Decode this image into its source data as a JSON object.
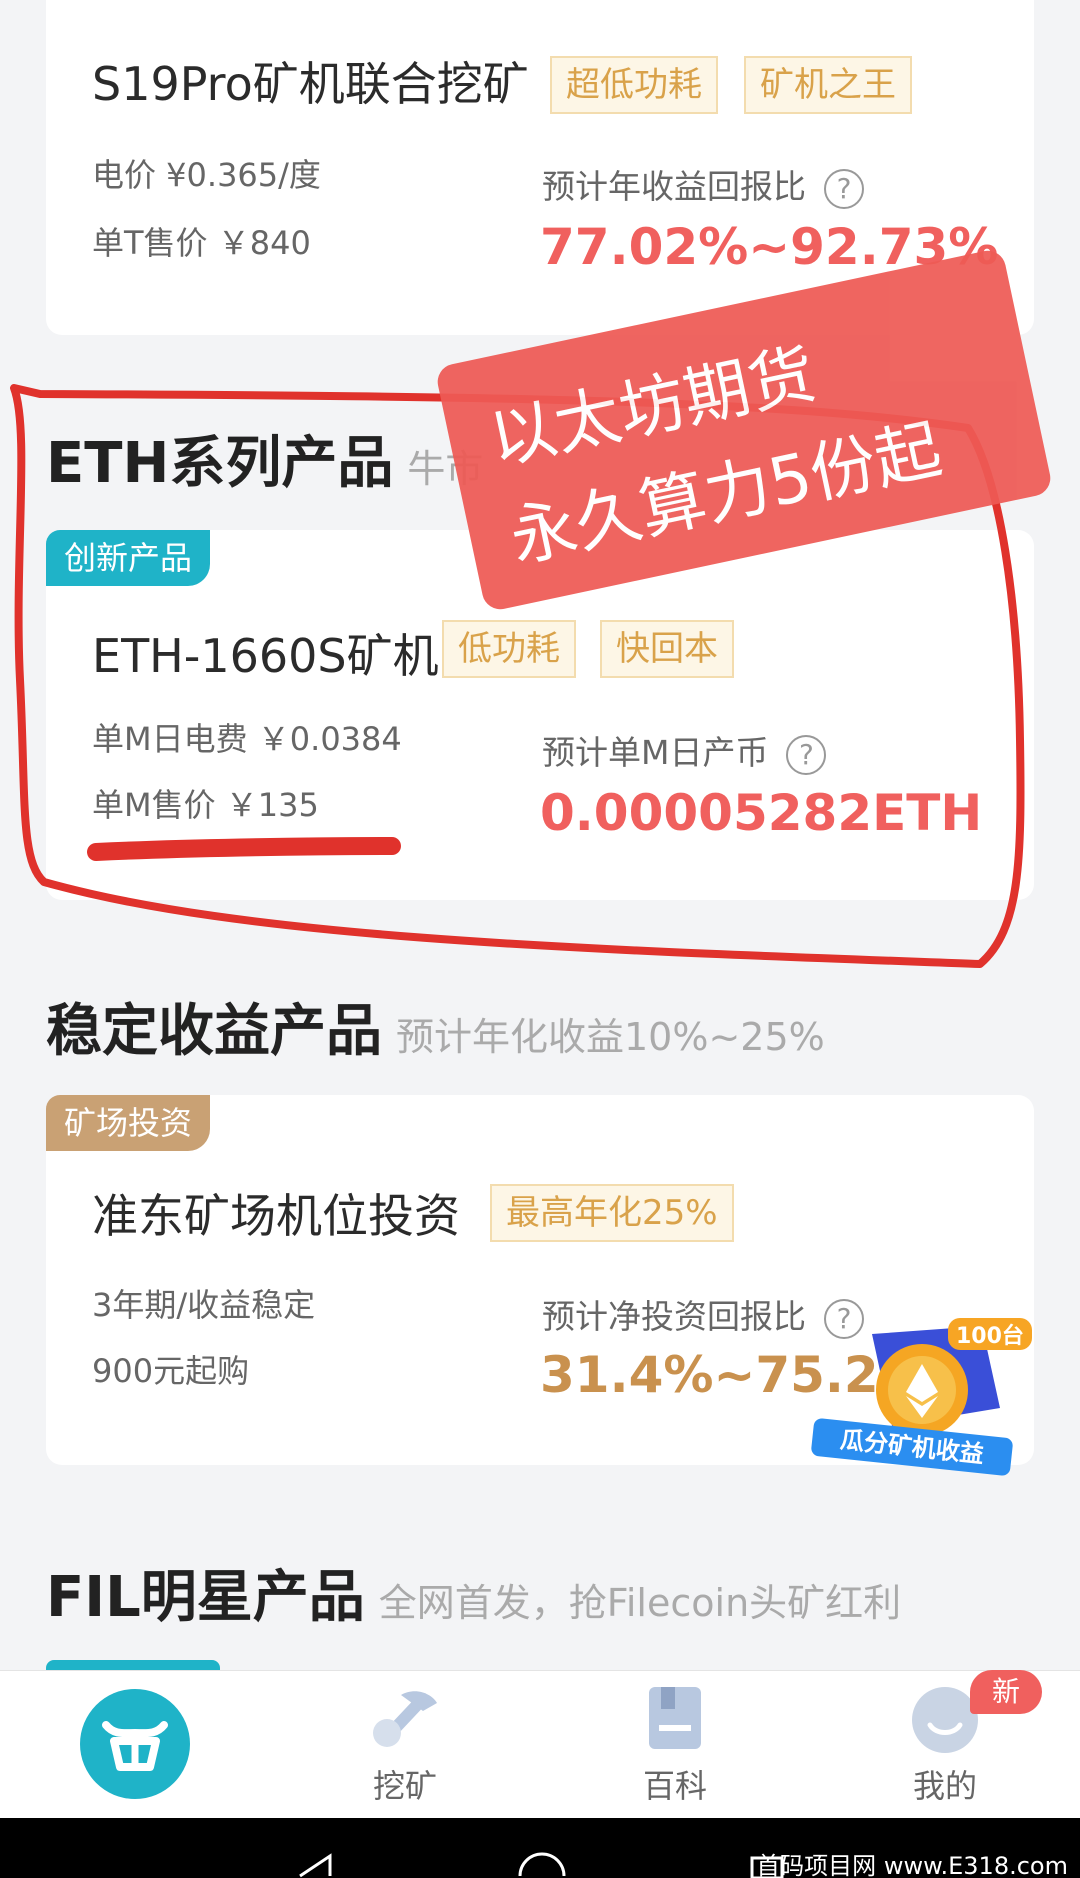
{
  "products": {
    "s19": {
      "title": "S19Pro矿机联合挖矿",
      "tags": [
        "超低功耗",
        "矿机之王"
      ],
      "line1": "电价 ¥0.365/度",
      "line2": "单T售价 ￥840",
      "metric_label": "预计年收益回报比",
      "metric_value": "77.02%~92.73%"
    },
    "eth": {
      "badge": "创新产品",
      "title": "ETH-1660S矿机",
      "tags": [
        "低功耗",
        "快回本"
      ],
      "line1": "单M日电费 ￥0.0384",
      "line2": "单M售价 ￥135",
      "metric_label": "预计单M日产币",
      "metric_value": "0.00005282ETH"
    },
    "invest": {
      "badge": "矿场投资",
      "title": "准东矿场机位投资",
      "tags": [
        "最高年化25%"
      ],
      "line1": "3年期/收益稳定",
      "line2": "900元起购",
      "metric_label": "预计净投资回报比",
      "metric_value": "31.4%~75.2%"
    }
  },
  "sections": {
    "eth": {
      "heading": "ETH系列产品",
      "sub": "牛市"
    },
    "stable": {
      "heading": "稳定收益产品",
      "sub": "预计年化收益10%~25%"
    },
    "fil": {
      "heading": "FIL明星产品",
      "sub": "全网首发，抢Filecoin头矿红利"
    }
  },
  "overlay_stamp": {
    "line1": "以太坊期货",
    "line2": "永久算力5份起"
  },
  "promo_widget": {
    "count": "100台",
    "label": "瓜分矿机收益"
  },
  "help_glyph": "?",
  "bottom_nav": {
    "items": [
      {
        "label": ""
      },
      {
        "label": "挖矿"
      },
      {
        "label": "百科"
      },
      {
        "label": "我的"
      }
    ],
    "new_badge": "新"
  },
  "watermark": "首码项目网 www.E318.com",
  "colors": {
    "accent_red": "#f0605e",
    "accent_blue": "#1fb3c8",
    "gold": "#c9914e",
    "tag_text": "#d9a24a",
    "annotation_red": "#e0322c"
  }
}
